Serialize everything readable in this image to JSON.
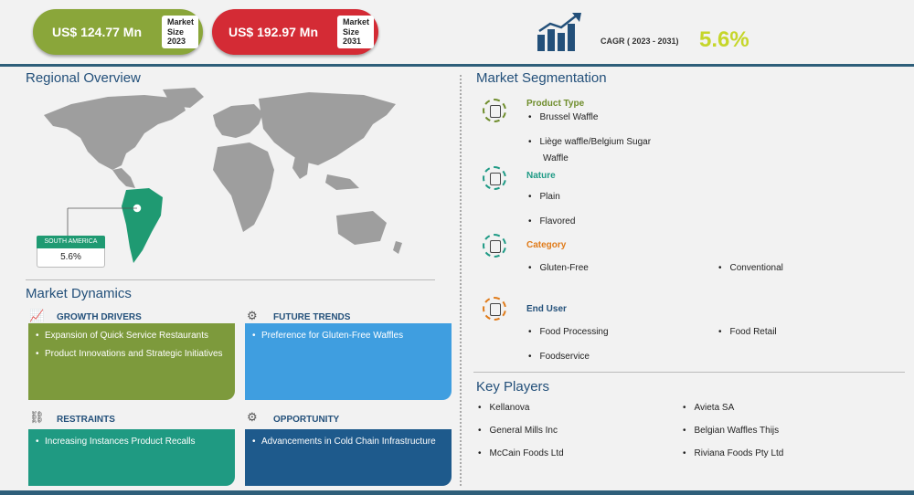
{
  "header": {
    "size_2023": {
      "value": "US$ 124.77 Mn",
      "label": [
        "Market",
        "Size",
        "2023"
      ],
      "color": "#8aa63a"
    },
    "size_2031": {
      "value": "US$ 192.97 Mn",
      "label": [
        "Market",
        "Size",
        "2031"
      ],
      "color": "#d42b35"
    },
    "cagr_label": "CAGR ( 2023 - 2031)",
    "cagr_value": "5.6%"
  },
  "regional": {
    "title": "Regional Overview",
    "region_name": "SOUTH AMERICA",
    "region_value": "5.6%"
  },
  "dynamics": {
    "title": "Market Dynamics",
    "growth": {
      "title": "GROWTH DRIVERS",
      "items": [
        "Expansion of Quick Service Restaurants",
        "Product Innovations and Strategic Initiatives"
      ],
      "color": "#7d9a3c"
    },
    "future": {
      "title": "FUTURE TRENDS",
      "items": [
        "Preference for Gluten-Free Waffles"
      ],
      "color": "#3f9ee0"
    },
    "restraints": {
      "title": "RESTRAINTS",
      "items": [
        "Increasing Instances Product Recalls"
      ],
      "color": "#1f9a82"
    },
    "opportunity": {
      "title": "OPPORTUNITY",
      "items": [
        "Advancements in Cold Chain Infrastructure"
      ],
      "color": "#1e5a8c"
    }
  },
  "segmentation": {
    "title": "Market Segmentation",
    "product_type": {
      "title": "Product Type",
      "color": "#6f8d2c",
      "items": [
        "Brussel Waffle",
        "Liège waffle/Belgium Sugar",
        "Waffle"
      ]
    },
    "nature": {
      "title": "Nature",
      "color": "#1e9a85",
      "items": [
        "Plain",
        "Flavored"
      ]
    },
    "category": {
      "title": "Category",
      "color": "#e07b1a",
      "items": [
        "Gluten-Free",
        "Conventional"
      ]
    },
    "end_user": {
      "title": "End User",
      "color": "#23507a",
      "items": [
        "Food Processing",
        "Food Retail",
        "Foodservice"
      ]
    }
  },
  "key_players": {
    "title": "Key Players",
    "items": [
      "Kellanova",
      "Avieta SA",
      "General Mills Inc",
      "Belgian Waffles Thijs",
      "McCain Foods Ltd",
      "Riviana Foods Pty Ltd"
    ]
  }
}
